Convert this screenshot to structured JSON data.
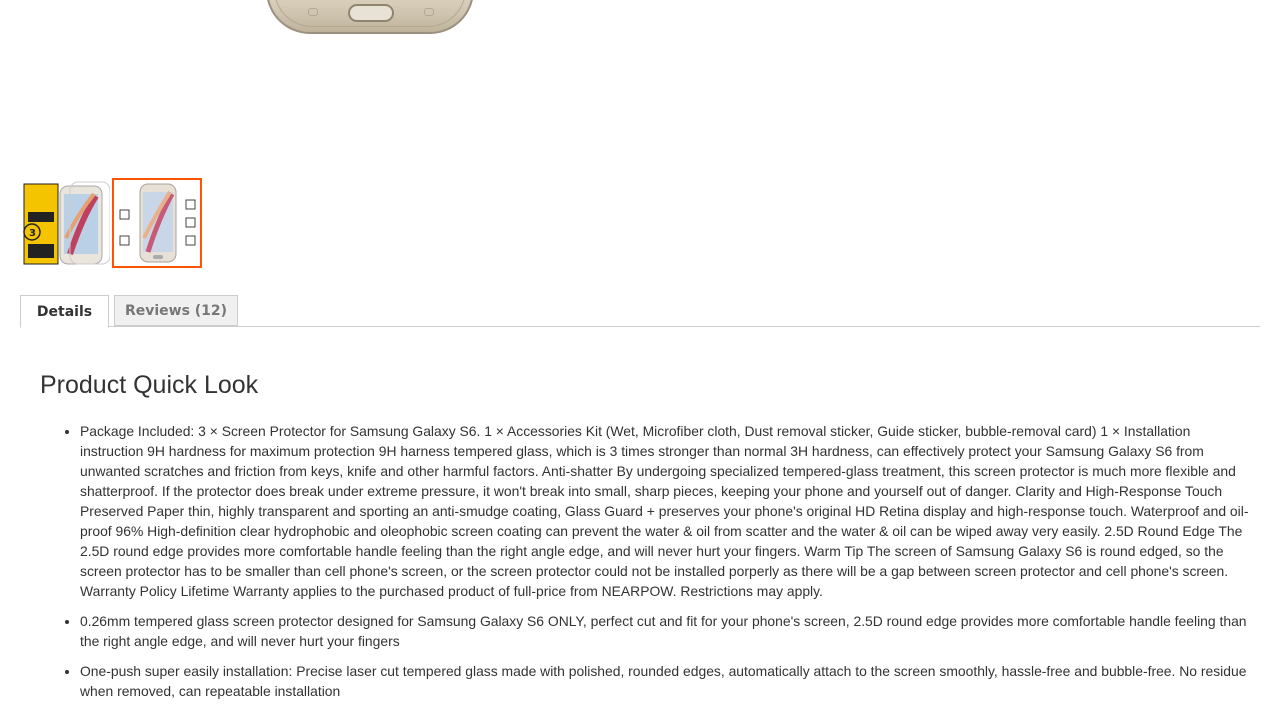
{
  "colors": {
    "accent": "#ff5501",
    "tab_border": "#cccccc",
    "inactive_tab_bg": "#f0f0f0"
  },
  "tabs": [
    {
      "label": "Details",
      "active": true
    },
    {
      "label": "Reviews (12)",
      "active": false
    }
  ],
  "thumbnails": [
    {
      "name": "product-thumbnail-package",
      "selected": false
    },
    {
      "name": "product-thumbnail-phone",
      "selected": true
    }
  ],
  "details": {
    "title": "Product Quick Look",
    "bullets": [
      "Package Included: 3 × Screen Protector for Samsung Galaxy S6. 1 × Accessories Kit (Wet, Microfiber cloth, Dust removal sticker, Guide sticker, bubble-removal card) 1 × Installation instruction 9H hardness for maximum protection 9H harness tempered glass, which is 3 times stronger than normal 3H hardness, can effectively protect your Samsung Galaxy S6 from unwanted scratches and friction from keys, knife and other harmful factors. Anti-shatter By undergoing specialized tempered-glass treatment, this screen protector is much more flexible and shatterproof. If the protector does break under extreme pressure, it won't break into small, sharp pieces, keeping your phone and yourself out of danger. Clarity and High-Response Touch Preserved Paper thin, highly transparent and sporting an anti-smudge coating, Glass Guard + preserves your phone's original HD Retina display and high-response touch. Waterproof and oil-proof 96% High-definition clear hydrophobic and oleophobic screen coating can prevent the water & oil from scatter and the water & oil can be wiped away very easily. 2.5D Round Edge The 2.5D round edge provides more comfortable handle feeling than the right angle edge, and will never hurt your fingers. Warm Tip The screen of Samsung Galaxy S6 is round edged, so the screen protector has to be smaller than cell phone's screen, or the screen protector could not be installed porperly as there will be a gap between screen protector and cell phone's screen. Warranty Policy Lifetime Warranty applies to the purchased product of full-price from NEARPOW. Restrictions may apply.",
      "0.26mm tempered glass screen protector designed for Samsung Galaxy S6 ONLY, perfect cut and fit for your phone's screen, 2.5D round edge provides more comfortable handle feeling than the right angle edge, and will never hurt your fingers",
      "One-push super easily installation: Precise laser cut tempered glass made with polished, rounded edges, automatically attach to the screen smoothly, hassle-free and bubble-free. No residue when removed, can repeatable installation"
    ]
  }
}
